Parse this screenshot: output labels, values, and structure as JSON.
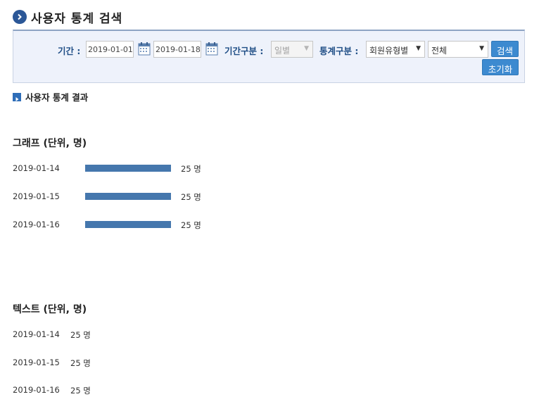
{
  "header": {
    "title": "사용자 통계 검색"
  },
  "search": {
    "period_label": "기간 :",
    "start_date": "2019-01-01",
    "end_date": "2019-01-18",
    "period_type_label": "기간구분 :",
    "period_type_value": "일별",
    "stat_type_label": "통계구분 :",
    "stat_type_value": "회원유형별",
    "member_type_value": "전체",
    "search_button": "검색",
    "reset_button": "초기화"
  },
  "result": {
    "title": "사용자 통계 결과"
  },
  "graph": {
    "title": "그래프 (단위, 명)",
    "unit": "명",
    "rows": [
      {
        "date": "2019-01-14",
        "value": 25,
        "label": "25 명"
      },
      {
        "date": "2019-01-15",
        "value": 25,
        "label": "25 명"
      },
      {
        "date": "2019-01-16",
        "value": 25,
        "label": "25 명"
      }
    ]
  },
  "text_section": {
    "title": "텍스트 (단위, 명)",
    "rows": [
      {
        "date": "2019-01-14",
        "label": "25 명"
      },
      {
        "date": "2019-01-15",
        "label": "25 명"
      },
      {
        "date": "2019-01-16",
        "label": "25 명"
      }
    ]
  },
  "colors": {
    "accent": "#2b5797",
    "bar": "#4577ad",
    "button": "#3d8ad0",
    "label": "#1f4e86"
  }
}
